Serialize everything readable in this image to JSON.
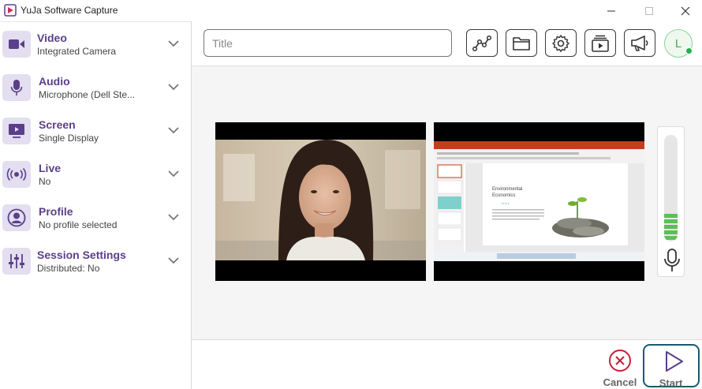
{
  "window": {
    "title": "YuJa Software Capture"
  },
  "sidebar": {
    "items": [
      {
        "title": "Video",
        "subtitle": "Integrated Camera",
        "icon": "video-camera-icon"
      },
      {
        "title": "Audio",
        "subtitle": "Microphone (Dell Ste...",
        "icon": "microphone-icon"
      },
      {
        "title": "Screen",
        "subtitle": "Single Display",
        "icon": "screen-icon"
      },
      {
        "title": "Live",
        "subtitle": "No",
        "icon": "broadcast-icon"
      },
      {
        "title": "Profile",
        "subtitle": "No profile selected",
        "icon": "profile-icon"
      },
      {
        "title": "Session Settings",
        "subtitle": "Distributed: No",
        "icon": "sliders-icon"
      }
    ]
  },
  "toolbar": {
    "title_placeholder": "Title",
    "title_value": "",
    "buttons": [
      "analytics-icon",
      "folder-icon",
      "gear-icon",
      "media-library-icon",
      "megaphone-icon"
    ],
    "avatar_initial": "L",
    "avatar_status": "online"
  },
  "preview": {
    "slide_title_line1": "Environmental",
    "slide_title_line2": "Economics"
  },
  "audio_meter": {
    "level_fraction": 0.28
  },
  "actions": {
    "cancel_label": "Cancel",
    "start_label": "Start"
  },
  "colors": {
    "accent_purple": "#5a3f8a",
    "icon_bg": "#e3def0",
    "cancel_red": "#c4213a",
    "start_border": "#1a5a6e",
    "meter_green": "#5cbf56",
    "presence_green": "#22b04a"
  }
}
